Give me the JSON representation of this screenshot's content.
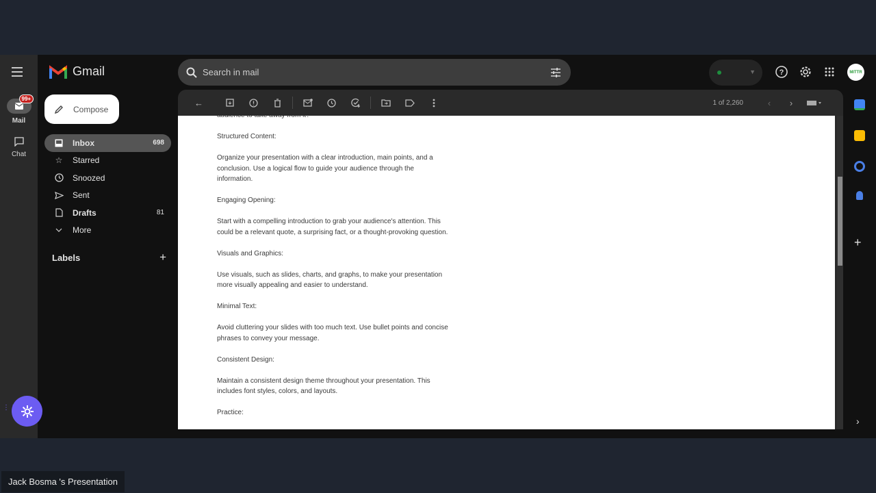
{
  "app": {
    "name": "Gmail"
  },
  "rail": {
    "mail_label": "Mail",
    "mail_badge": "99+",
    "chat_label": "Chat"
  },
  "compose_label": "Compose",
  "nav": [
    {
      "label": "Inbox",
      "count": "698",
      "icon": "inbox-icon",
      "active": true
    },
    {
      "label": "Starred",
      "count": "",
      "icon": "star-icon"
    },
    {
      "label": "Snoozed",
      "count": "",
      "icon": "clock-icon"
    },
    {
      "label": "Sent",
      "count": "",
      "icon": "send-icon"
    },
    {
      "label": "Drafts",
      "count": "81",
      "icon": "draft-icon"
    },
    {
      "label": "More",
      "count": "",
      "icon": "chevron-down-icon"
    }
  ],
  "labels_heading": "Labels",
  "search": {
    "placeholder": "Search in mail"
  },
  "avatar_text": "MITTR",
  "pager": {
    "count": "1 of 2,260"
  },
  "message": {
    "paragraphs": [
      "audience to take away from it?",
      "Structured Content:",
      "Organize your presentation with a clear introduction, main points, and a conclusion. Use a logical flow to guide your audience through the information.",
      "Engaging Opening:",
      "Start with a compelling introduction to grab your audience's attention. This could be a relevant quote, a surprising fact, or a thought-provoking question.",
      "Visuals and Graphics:",
      "Use visuals, such as slides, charts, and graphs, to make your presentation more visually appealing and easier to understand.",
      "Minimal Text:",
      "Avoid cluttering your slides with too much text. Use bullet points and concise phrases to convey your message.",
      "Consistent Design:",
      "Maintain a consistent design theme throughout your presentation. This includes font styles, colors, and layouts.",
      "Practice:"
    ]
  },
  "caption": "Jack Bosma 's Presentation",
  "colors": {
    "accent": "#6c5cf2",
    "badge": "#c5221f",
    "active_nav": "#555555"
  }
}
